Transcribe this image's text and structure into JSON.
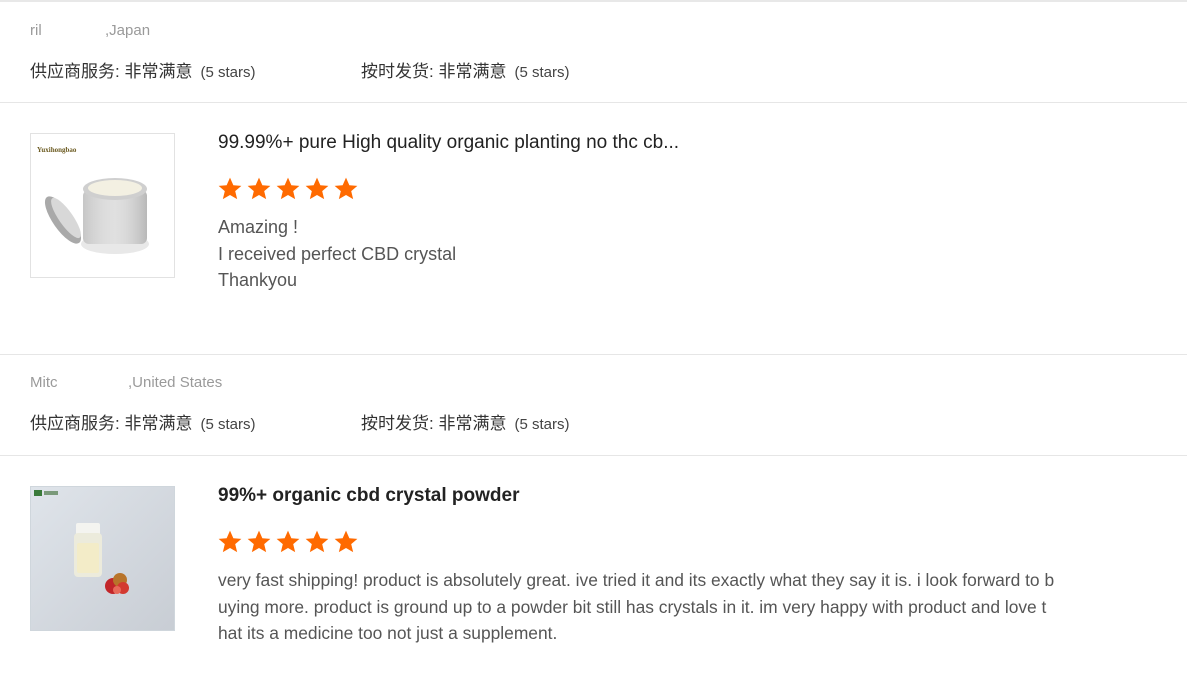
{
  "reviews": [
    {
      "buyer_name": "ril",
      "buyer_country": ",Japan",
      "supplier_service": {
        "label": "供应商服务: 非常满意",
        "stars_text": "(5 stars)"
      },
      "ship_on_time": {
        "label": "按时发货: 非常满意",
        "stars_text": "(5 stars)"
      },
      "product_title": "99.99%+ pure High quality organic planting no thc cb...",
      "rating": 5,
      "thumbnail_caption": "Yuxihongbao",
      "text_lines": [
        "Amazing !",
        "I received perfect CBD crystal",
        "Thankyou"
      ]
    },
    {
      "buyer_name": "Mitc",
      "buyer_country": ",United States",
      "supplier_service": {
        "label": "供应商服务: 非常满意",
        "stars_text": "(5 stars)"
      },
      "ship_on_time": {
        "label": "按时发货: 非常满意",
        "stars_text": "(5 stars)"
      },
      "product_title": "99%+ organic cbd crystal powder",
      "rating": 5,
      "text_lines": [
        "very fast shipping! product is absolutely great. ive tried it and its exactly what they say it is. i look forward to b",
        "uying more. product is ground up to a powder bit still has crystals in it. im very happy with product and love t",
        "hat its a medicine too not just a supplement."
      ]
    }
  ],
  "colors": {
    "star": "#ff6a00",
    "divider": "#e6e6e6",
    "meta_text": "#9a9a9a"
  },
  "icons": {
    "rating_star": "star-icon"
  }
}
